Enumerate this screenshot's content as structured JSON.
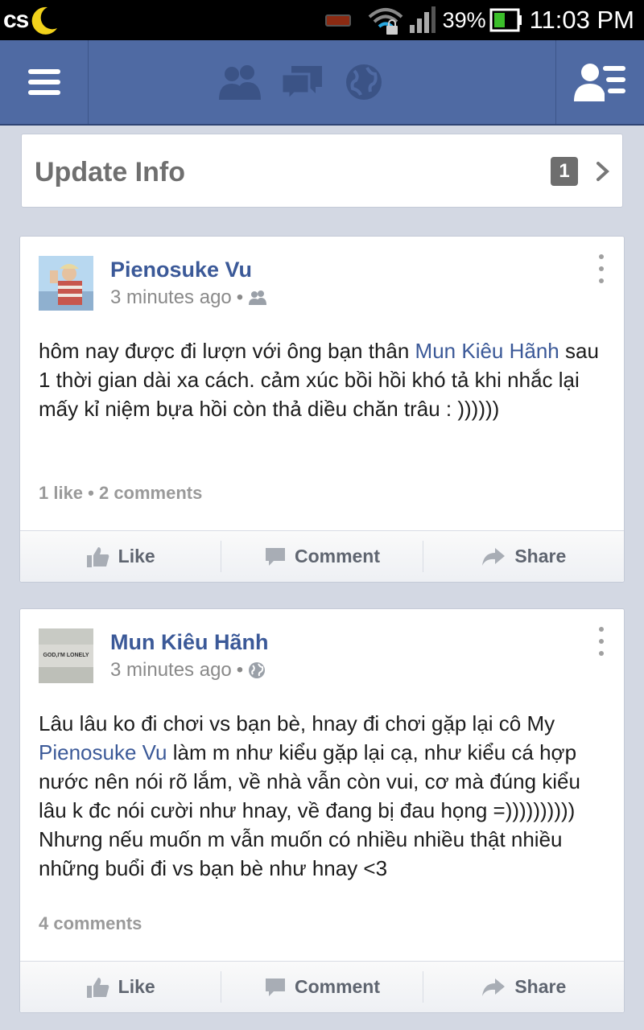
{
  "status_bar": {
    "logo_text": "cs",
    "battery_percent": "39%",
    "time": "11:03 PM",
    "icons": [
      "moon-logo-icon",
      "battery-saver-icon",
      "wifi-lock-icon",
      "signal-icon",
      "battery-icon"
    ]
  },
  "nav": {
    "icons": [
      "menu-icon",
      "friend-requests-icon",
      "messages-icon",
      "notifications-globe-icon",
      "profile-list-icon"
    ]
  },
  "update_info": {
    "label": "Update Info",
    "badge": "1"
  },
  "posts": [
    {
      "author": "Pienosuke Vu",
      "time": "3 minutes ago",
      "audience_icon": "friends-icon",
      "text_before": "hôm nay được đi lượn với ông bạn thân ",
      "mention": "Mun Kiêu Hãnh",
      "text_after": " sau 1 thời gian dài xa cách. cảm xúc bồi hồi khó tả khi nhắc lại mấy kỉ niệm bựa hồi còn thả diều chăn trâu : ))))))",
      "counts": "1 like • 2 comments",
      "actions": {
        "like": "Like",
        "comment": "Comment",
        "share": "Share"
      }
    },
    {
      "author": "Mun Kiêu Hãnh",
      "time": "3 minutes ago",
      "audience_icon": "public-globe-icon",
      "avatar_text": "GOD,I'M LONELY",
      "text_before": "Lâu lâu ko đi chơi vs bạn bè, hnay đi chơi gặp lại cô My ",
      "mention": "Pienosuke Vu",
      "text_after": " làm m như kiểu gặp lại cạ, như kiểu cá hợp nước nên nói rõ lắm, về nhà vẫn còn vui, cơ mà đúng kiểu lâu k đc nói cười như hnay, về đang bị đau họng =)))))))))) Nhưng nếu muốn m vẫn muốn có nhiều nhiều thật nhiều những buổi đi vs bạn bè như hnay <3",
      "counts": "4 comments",
      "actions": {
        "like": "Like",
        "comment": "Comment",
        "share": "Share"
      }
    }
  ],
  "colors": {
    "nav_bg": "#4f6aa3",
    "page_bg": "#d3d8e3",
    "link": "#3b5998"
  }
}
